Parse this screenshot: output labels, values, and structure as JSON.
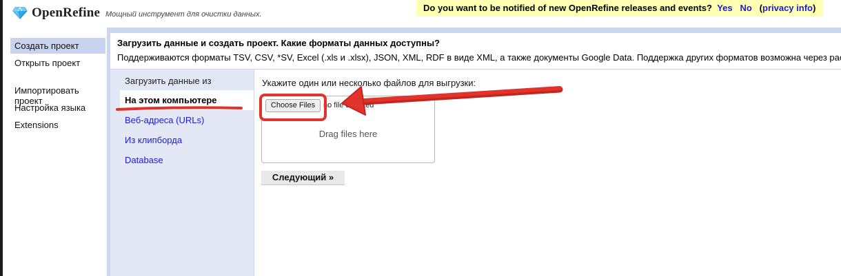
{
  "header": {
    "app_name": "OpenRefine",
    "tagline": "Мощный инструмент для очистки данных.",
    "notify": {
      "question": "Do you want to be notified of new OpenRefine releases and events?",
      "yes": "Yes",
      "no": "No",
      "open_paren": "(",
      "privacy": "privacy info",
      "close_paren": ")"
    }
  },
  "sidebar": {
    "items": [
      {
        "label": "Создать проект"
      },
      {
        "label": "Открыть проект"
      },
      {
        "label": "Импортировать\nпроект"
      },
      {
        "label": "Настройка языка"
      },
      {
        "label": "Extensions"
      }
    ]
  },
  "main": {
    "title": "Загрузить данные и создать проект. Какие форматы данных доступны?",
    "description": "Поддерживаются форматы TSV, CSV, *SV, Excel (.xls и .xlsx), JSON, XML, RDF в виде XML, а также документы Google Data. Поддержка других форматов возможна через расширения."
  },
  "sources": {
    "label": "Загрузить данные из",
    "items": [
      {
        "label": "На этом компьютере"
      },
      {
        "label": "Веб-адреса (URLs)"
      },
      {
        "label": "Из клипборда"
      },
      {
        "label": "Database"
      }
    ]
  },
  "upload": {
    "prompt": "Укажите один или несколько файлов для выгрузки:",
    "choose_files": "Choose Files",
    "no_file": "no file selected",
    "drag_text": "Drag files here",
    "next_button": "Следующий »"
  },
  "colors": {
    "annotation_red": "#e0332b",
    "link_blue": "#1a1adb",
    "notify_bg": "#ffffb3",
    "panel_blue": "#cdd6ef"
  }
}
